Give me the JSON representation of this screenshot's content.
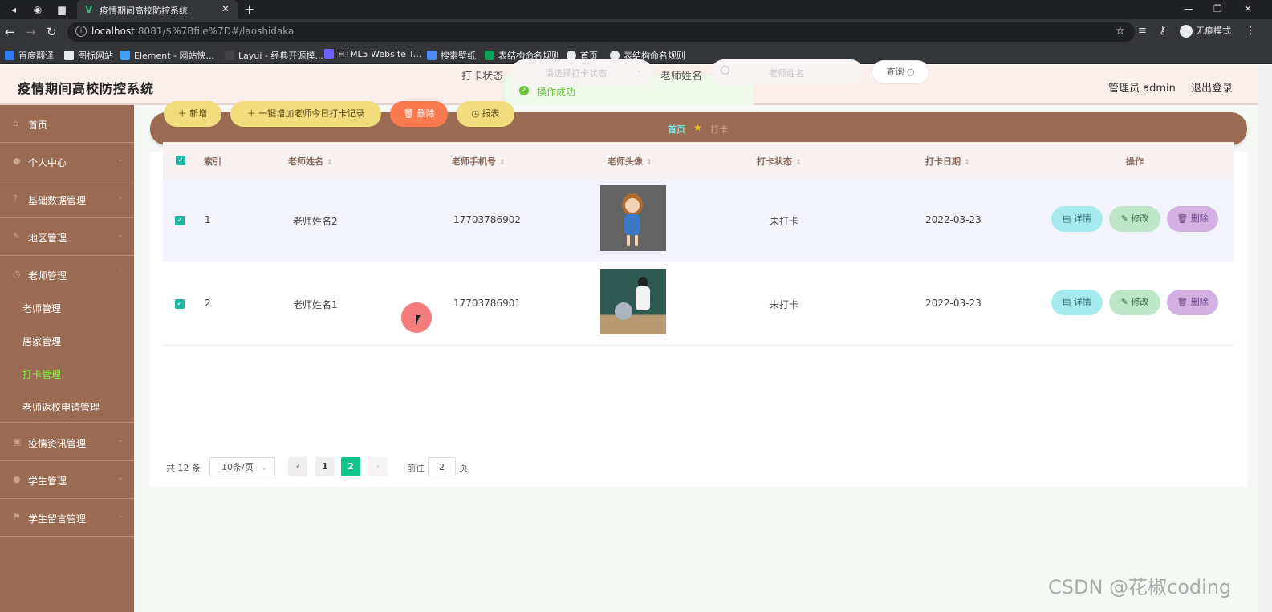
{
  "browser": {
    "tab_title": "疫情期间高校防控系统",
    "tab_favicon": "V",
    "url_host": "localhost",
    "url_rest": ":8081/$%7Bfile%7D#/laoshidaka",
    "incognito_label": "无痕模式",
    "bookmarks": [
      "百度翻译",
      "图标网站",
      "Element - 网站快...",
      "Layui - 经典开源模...",
      "HTML5 Website T...",
      "搜索壁纸",
      "表结构命名规则",
      "首页",
      "表结构命名规则"
    ]
  },
  "header": {
    "title": "疫情期间高校防控系统",
    "user": "管理员 admin",
    "logout": "退出登录"
  },
  "toast": {
    "text": "操作成功"
  },
  "sidebar": {
    "items": [
      {
        "label": "首页",
        "icon": "home-icon"
      },
      {
        "label": "个人中心",
        "icon": "user-icon"
      },
      {
        "label": "基础数据管理",
        "icon": "question-icon"
      },
      {
        "label": "地区管理",
        "icon": "edit-icon"
      },
      {
        "label": "老师管理",
        "icon": "clock-icon"
      }
    ],
    "subitems": [
      "老师管理",
      "居家管理",
      "打卡管理",
      "老师返校申请管理"
    ],
    "items_after": [
      {
        "label": "疫情资讯管理",
        "icon": "gallery-icon"
      },
      {
        "label": "学生管理",
        "icon": "user-icon"
      },
      {
        "label": "学生留言管理",
        "icon": "flag-icon"
      }
    ]
  },
  "breadcrumb": {
    "home": "首页",
    "current": "打卡"
  },
  "search": {
    "status_label": "打卡状态",
    "status_placeholder": "请选择打卡状态",
    "name_label": "老师姓名",
    "name_placeholder": "老师姓名",
    "query": "查询"
  },
  "actions": {
    "add": "新增",
    "oneclick": "一键增加老师今日打卡记录",
    "delete": "删除",
    "report": "报表"
  },
  "table": {
    "headers": [
      "索引",
      "老师姓名",
      "老师手机号",
      "老师头像",
      "打卡状态",
      "打卡日期",
      "操作"
    ],
    "rows": [
      {
        "index": "1",
        "name": "老师姓名2",
        "phone": "17703786902",
        "status": "未打卡",
        "date": "2022-03-23"
      },
      {
        "index": "2",
        "name": "老师姓名1",
        "phone": "17703786901",
        "status": "未打卡",
        "date": "2022-03-23"
      }
    ],
    "op_detail": "详情",
    "op_edit": "修改",
    "op_delete": "删除"
  },
  "pagination": {
    "total": "共 12 条",
    "page_size": "10条/页",
    "pages": [
      "1",
      "2"
    ],
    "current": 2,
    "goto_label": "前往",
    "goto_value": "2",
    "page_suffix": "页"
  },
  "watermark": "CSDN @花椒coding",
  "colors": {
    "sidebar": "#9a6a52",
    "accent_green": "#12c48c",
    "add_btn": "#f1dc7e",
    "delete_btn": "#f97a4f"
  }
}
